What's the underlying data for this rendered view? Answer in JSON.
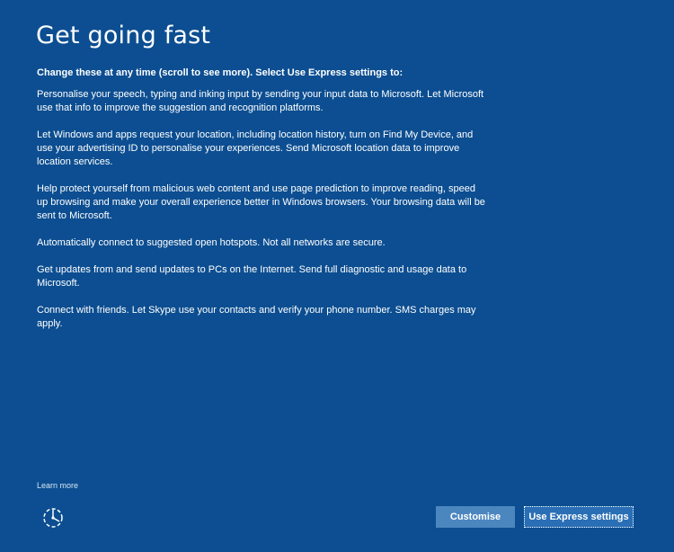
{
  "header": {
    "title": "Get going fast"
  },
  "main": {
    "lead": "Change these at any time (scroll to see more). Select Use Express settings to:",
    "paragraphs": [
      "Personalise your speech, typing and inking input by sending your input data to Microsoft. Let Microsoft use that info to improve the suggestion and recognition platforms.",
      "Let Windows and apps request your location, including location history, turn on Find My Device, and use your advertising ID to personalise your experiences. Send Microsoft location data to improve location services.",
      "Help protect yourself from malicious web content and use page prediction to improve reading, speed up browsing and make your overall experience better in Windows browsers. Your browsing data will be sent to Microsoft.",
      "Automatically connect to suggested open hotspots. Not all networks are secure.",
      "Get updates from and send updates to PCs on the Internet. Send full diagnostic and usage data to Microsoft.",
      "Connect with friends. Let Skype use your contacts and verify your phone number. SMS charges may apply."
    ]
  },
  "footer": {
    "learn_more": "Learn more",
    "accessibility_icon": "ease-of-access-icon",
    "customise_label": "Customise",
    "express_label": "Use Express settings"
  },
  "colors": {
    "background": "#0c4e91",
    "customise_button": "#4c86bf",
    "express_button": "#2a6fb5"
  }
}
